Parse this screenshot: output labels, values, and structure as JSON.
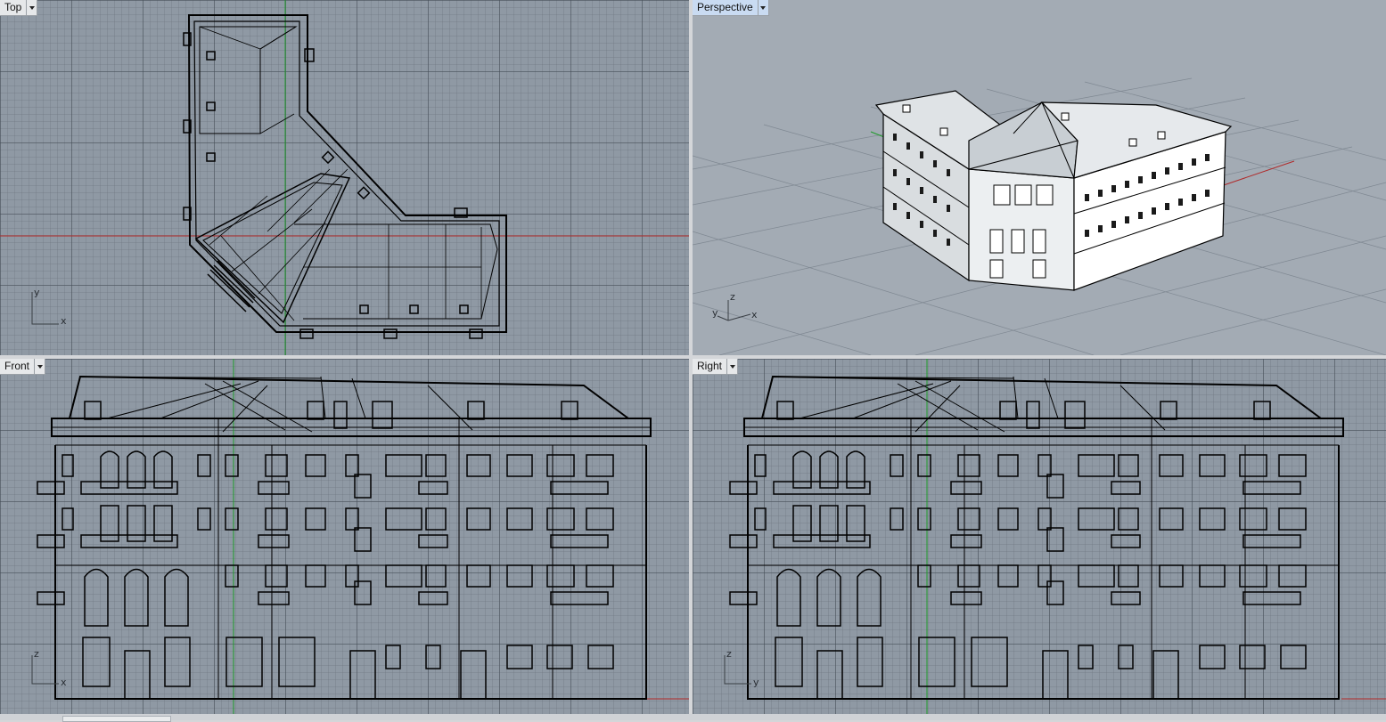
{
  "viewports": {
    "top": {
      "label": "Top",
      "axis_v": "y",
      "axis_h": "x",
      "active": false
    },
    "perspective": {
      "label": "Perspective",
      "axis_1": "z",
      "axis_2": "y",
      "axis_3": "x",
      "active": true
    },
    "front": {
      "label": "Front",
      "axis_v": "z",
      "axis_h": "x",
      "active": false
    },
    "right": {
      "label": "Right",
      "axis_v": "z",
      "axis_h": "y",
      "active": false
    }
  },
  "colors": {
    "viewport_bg": "#8f99a4",
    "perspective_bg": "#a3abb4",
    "active_tab": "#c9dbf2",
    "x_axis": "#b02a2a",
    "y_axis": "#1f9a2a",
    "wire": "#000000"
  },
  "icons": [
    "viewport-menu-arrow-icon"
  ]
}
